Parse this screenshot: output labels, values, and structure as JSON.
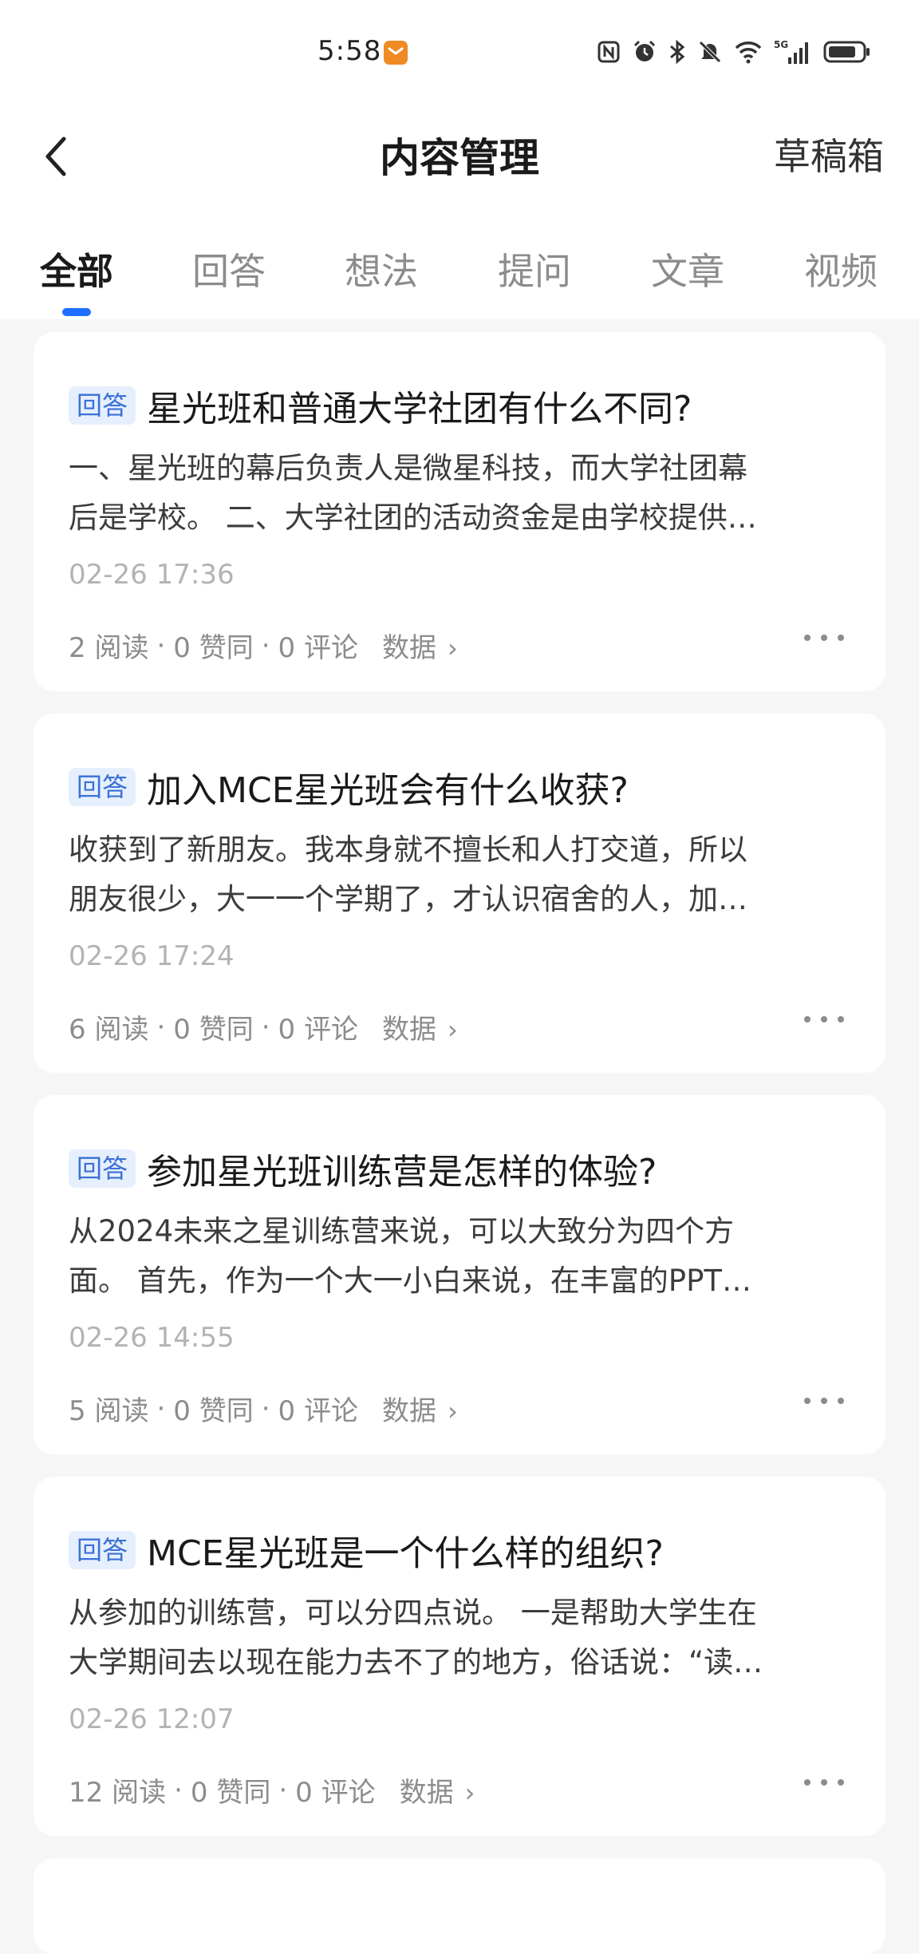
{
  "status_bar": {
    "time": "5:58",
    "app_icon": "notification-app-icon",
    "icons": [
      "nfc-icon",
      "alarm-icon",
      "bluetooth-icon",
      "mute-icon",
      "wifi-icon",
      "5g-signal-icon",
      "battery-icon"
    ]
  },
  "header": {
    "title": "内容管理",
    "right_action": "草稿箱",
    "back_icon": "chevron-left-icon"
  },
  "tabs": [
    {
      "label": "全部",
      "active": true
    },
    {
      "label": "回答",
      "active": false
    },
    {
      "label": "想法",
      "active": false
    },
    {
      "label": "提问",
      "active": false
    },
    {
      "label": "文章",
      "active": false
    },
    {
      "label": "视频",
      "active": false
    }
  ],
  "accent_color": "#1e6fff",
  "tag_color": "#3b71d6",
  "cards": [
    {
      "tag": "回答",
      "title": "星光班和普通大学社团有什么不同?",
      "excerpt_line1": "一、星光班的幕后负责人是微星科技，而大学社团幕",
      "excerpt_line2": "后是学校。 二、大学社团的活动资金是由学校提供…",
      "date": "02-26 17:36",
      "reads": "2 阅读",
      "likes": "0 赞同",
      "comments": "0 评论",
      "data_label": "数据"
    },
    {
      "tag": "回答",
      "title": "加入MCE星光班会有什么收获?",
      "excerpt_line1": "收获到了新朋友。我本身就不擅长和人打交道，所以",
      "excerpt_line2": "朋友很少，大一一个学期了，才认识宿舍的人，加…",
      "date": "02-26 17:24",
      "reads": "6 阅读",
      "likes": "0 赞同",
      "comments": "0 评论",
      "data_label": "数据"
    },
    {
      "tag": "回答",
      "title": "参加星光班训练营是怎样的体验?",
      "excerpt_line1": "从2024未来之星训练营来说，可以大致分为四个方",
      "excerpt_line2": "面。 首先，作为一个大一小白来说，在丰富的PPT…",
      "date": "02-26 14:55",
      "reads": "5 阅读",
      "likes": "0 赞同",
      "comments": "0 评论",
      "data_label": "数据"
    },
    {
      "tag": "回答",
      "title": "MCE星光班是一个什么样的组织?",
      "excerpt_line1": "从参加的训练营，可以分四点说。 一是帮助大学生在",
      "excerpt_line2": "大学期间去以现在能力去不了的地方，俗话说：“读…",
      "date": "02-26 12:07",
      "reads": "12 阅读",
      "likes": "0 赞同",
      "comments": "0 评论",
      "data_label": "数据"
    }
  ]
}
